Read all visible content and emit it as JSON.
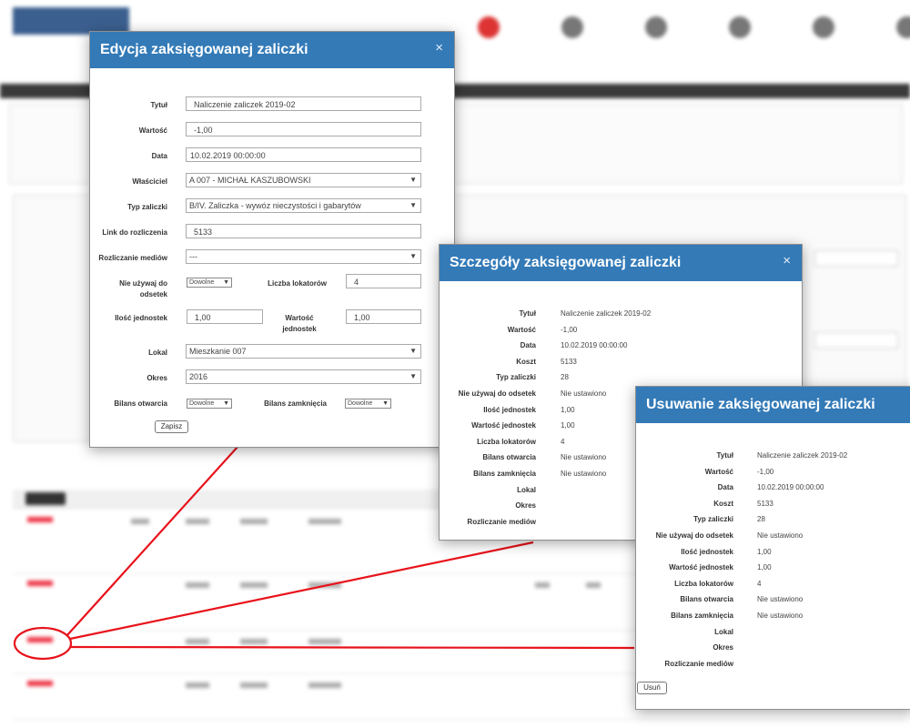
{
  "edit_modal": {
    "title": "Edycja zaksięgowanej zaliczki",
    "close": "×",
    "fields": {
      "tytul_label": "Tytuł",
      "tytul_value": "Naliczenie zaliczek 2019-02",
      "wartosc_label": "Wartość",
      "wartosc_value": "-1,00",
      "data_label": "Data",
      "data_value": "10.02.2019 00:00:00",
      "wlasciciel_label": "Właściciel",
      "wlasciciel_value": "A 007 - MICHAŁ KASZUBOWSKI",
      "typ_label": "Typ zaliczki",
      "typ_value": "B/IV. Zaliczka - wywóz nieczystości i gabarytów",
      "link_label": "Link do rozliczenia",
      "link_value": "5133",
      "rozliczanie_label": "Rozliczanie mediów",
      "rozliczanie_value": "---",
      "nie_uzywaj_label_1": "Nie używaj do",
      "nie_uzywaj_label_2": "odsetek",
      "nie_uzywaj_value": "Dowolne",
      "liczba_lokatorow_label": "Liczba lokatorów",
      "liczba_lokatorow_value": "4",
      "ilosc_jednostek_label": "Ilość jednostek",
      "ilosc_jednostek_value": "1,00",
      "wartosc_jednostek_label_1": "Wartość",
      "wartosc_jednostek_label_2": "jednostek",
      "wartosc_jednostek_value": "1,00",
      "lokal_label": "Lokal",
      "lokal_value": "Mieszkanie 007",
      "okres_label": "Okres",
      "okres_value": "2016",
      "bilans_otwarcia_label": "Bilans otwarcia",
      "bilans_otwarcia_value": "Dowolne",
      "bilans_zamkniecia_label": "Bilans zamknięcia",
      "bilans_zamkniecia_value": "Dowolne"
    },
    "save_button": "Zapisz"
  },
  "details_modal": {
    "title": "Szczegóły zaksięgowanej zaliczki",
    "close": "×",
    "rows": [
      {
        "key": "Tytuł",
        "value": "Naliczenie zaliczek 2019-02"
      },
      {
        "key": "Wartość",
        "value": "-1,00"
      },
      {
        "key": "Data",
        "value": "10.02.2019 00:00:00"
      },
      {
        "key": "Koszt",
        "value": "5133"
      },
      {
        "key": "Typ zaliczki",
        "value": "28"
      },
      {
        "key": "Nie używaj do odsetek",
        "value": "Nie ustawiono"
      },
      {
        "key": "Ilość jednostek",
        "value": "1,00"
      },
      {
        "key": "Wartość jednostek",
        "value": "1,00"
      },
      {
        "key": "Liczba lokatorów",
        "value": "4"
      },
      {
        "key": "Bilans otwarcia",
        "value": "Nie ustawiono"
      },
      {
        "key": "Bilans zamknięcia",
        "value": "Nie ustawiono"
      },
      {
        "key": "Lokal",
        "value": ""
      },
      {
        "key": "Okres",
        "value": ""
      },
      {
        "key": "Rozliczanie mediów",
        "value": ""
      }
    ]
  },
  "delete_modal": {
    "title": "Usuwanie zaksięgowanej zaliczki",
    "rows": [
      {
        "key": "Tytuł",
        "value": "Naliczenie zaliczek 2019-02"
      },
      {
        "key": "Wartość",
        "value": "-1,00"
      },
      {
        "key": "Data",
        "value": "10.02.2019 00:00:00"
      },
      {
        "key": "Koszt",
        "value": "5133"
      },
      {
        "key": "Typ zaliczki",
        "value": "28"
      },
      {
        "key": "Nie używaj do odsetek",
        "value": "Nie ustawiono"
      },
      {
        "key": "Ilość jednostek",
        "value": "1,00"
      },
      {
        "key": "Wartość jednostek",
        "value": "1,00"
      },
      {
        "key": "Liczba lokatorów",
        "value": "4"
      },
      {
        "key": "Bilans otwarcia",
        "value": "Nie ustawiono"
      },
      {
        "key": "Bilans zamknięcia",
        "value": "Nie ustawiono"
      },
      {
        "key": "Lokal",
        "value": ""
      },
      {
        "key": "Okres",
        "value": ""
      },
      {
        "key": "Rozliczanie mediów",
        "value": ""
      }
    ],
    "delete_button": "Usuń"
  },
  "colors": {
    "header_blue": "#337ab7",
    "annotation_red": "#e8131b"
  }
}
